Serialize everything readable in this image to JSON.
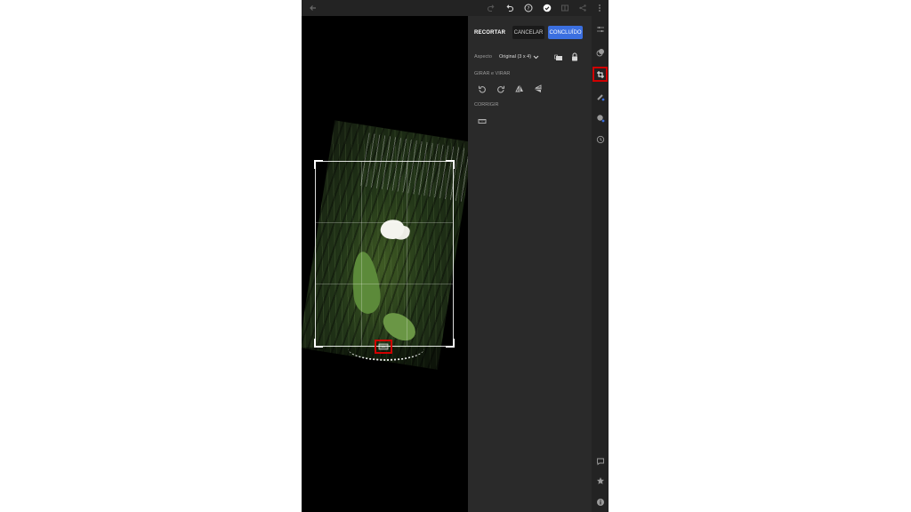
{
  "panel": {
    "title": "RECORTAR",
    "cancel_label": "CANCELAR",
    "done_label": "CONCLUÍDO",
    "aspect_label": "Aspecto",
    "aspect_value": "Original (3 x 4)",
    "rotate_flip_label": "GIRAR e VIRAR",
    "correct_label": "CORRIGIR"
  },
  "icons": {
    "back": "back-arrow-icon",
    "redo": "redo-icon",
    "undo": "undo-icon",
    "help": "help-icon",
    "check": "check-circle-icon",
    "compare": "compare-icon",
    "share": "share-icon",
    "more": "more-vertical-icon",
    "rail": [
      "adjust-sliders-icon",
      "presets-icon",
      "crop-rotate-icon",
      "healing-brush-icon",
      "selective-icon",
      "history-icon",
      "comment-icon",
      "star-icon",
      "info-icon"
    ]
  },
  "colors": {
    "accent": "#3b6fe0",
    "highlight": "#d00000",
    "panel_bg": "#2a2a2a",
    "canvas_bg": "#000000"
  }
}
